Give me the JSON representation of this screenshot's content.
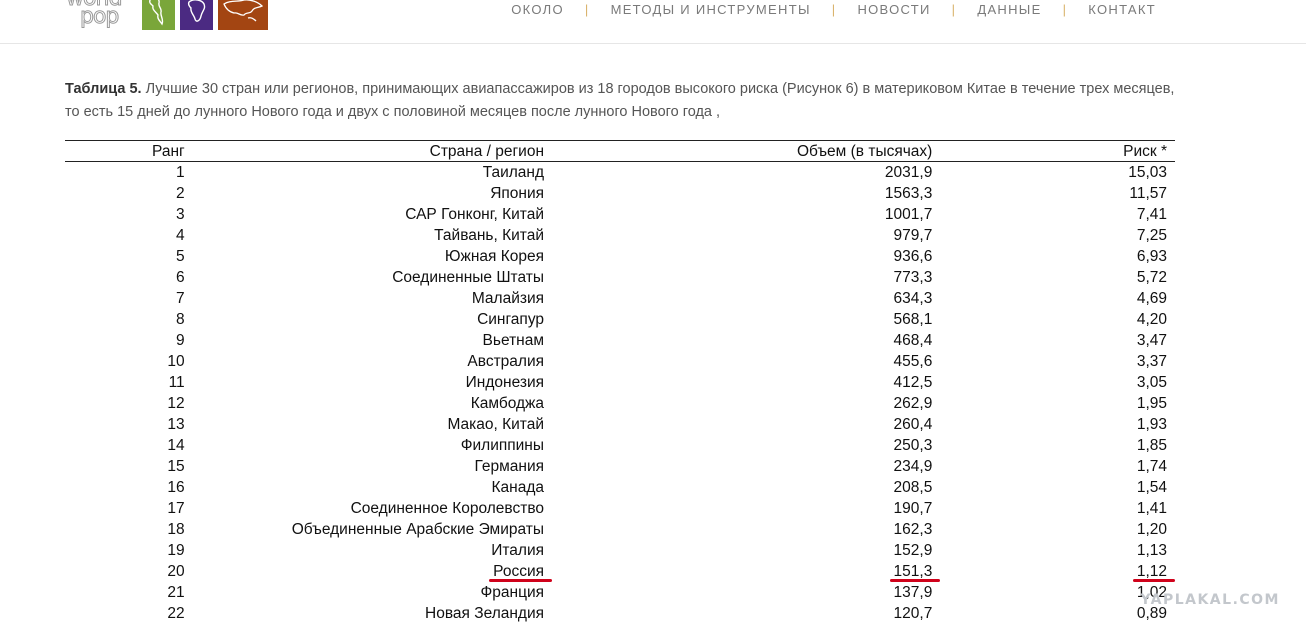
{
  "header": {
    "logo": {
      "line1": "world",
      "line2": "pop",
      "colors": [
        "#7aa63a",
        "#4b2a82",
        "#a34512"
      ]
    },
    "nav": [
      {
        "label": "ОКОЛО"
      },
      {
        "label": "МЕТОДЫ И ИНСТРУМЕНТЫ"
      },
      {
        "label": "НОВОСТИ"
      },
      {
        "label": "ДАННЫЕ"
      },
      {
        "label": "КОНТАКТ"
      }
    ]
  },
  "caption": {
    "label": "Таблица 5.",
    "text": "Лучшие 30 стран или регионов, принимающих авиапассажиров из 18 городов высокого риска (Рисунок 6) в материковом Китае в течение трех месяцев, то есть 15 дней до лунного Нового года и двух с половиной месяцев после лунного Нового года ,"
  },
  "table": {
    "headers": {
      "rank": "Ранг",
      "country": "Страна / регион",
      "volume": "Объем (в тысячах)",
      "risk": "Риск *"
    },
    "rows": [
      {
        "rank": "1",
        "country": "Таиланд",
        "volume": "2031,9",
        "risk": "15,03"
      },
      {
        "rank": "2",
        "country": "Япония",
        "volume": "1563,3",
        "risk": "11,57"
      },
      {
        "rank": "3",
        "country": "САР Гонконг, Китай",
        "volume": "1001,7",
        "risk": "7,41"
      },
      {
        "rank": "4",
        "country": "Тайвань, Китай",
        "volume": "979,7",
        "risk": "7,25"
      },
      {
        "rank": "5",
        "country": "Южная Корея",
        "volume": "936,6",
        "risk": "6,93"
      },
      {
        "rank": "6",
        "country": "Соединенные Штаты",
        "volume": "773,3",
        "risk": "5,72"
      },
      {
        "rank": "7",
        "country": "Малайзия",
        "volume": "634,3",
        "risk": "4,69"
      },
      {
        "rank": "8",
        "country": "Сингапур",
        "volume": "568,1",
        "risk": "4,20"
      },
      {
        "rank": "9",
        "country": "Вьетнам",
        "volume": "468,4",
        "risk": "3,47"
      },
      {
        "rank": "10",
        "country": "Австралия",
        "volume": "455,6",
        "risk": "3,37"
      },
      {
        "rank": "11",
        "country": "Индонезия",
        "volume": "412,5",
        "risk": "3,05"
      },
      {
        "rank": "12",
        "country": "Камбоджа",
        "volume": "262,9",
        "risk": "1,95"
      },
      {
        "rank": "13",
        "country": "Макао, Китай",
        "volume": "260,4",
        "risk": "1,93"
      },
      {
        "rank": "14",
        "country": "Филиппины",
        "volume": "250,3",
        "risk": "1,85"
      },
      {
        "rank": "15",
        "country": "Германия",
        "volume": "234,9",
        "risk": "1,74"
      },
      {
        "rank": "16",
        "country": "Канада",
        "volume": "208,5",
        "risk": "1,54"
      },
      {
        "rank": "17",
        "country": "Соединенное Королевство",
        "volume": "190,7",
        "risk": "1,41"
      },
      {
        "rank": "18",
        "country": "Объединенные Арабские Эмираты",
        "volume": "162,3",
        "risk": "1,20"
      },
      {
        "rank": "19",
        "country": "Италия",
        "volume": "152,9",
        "risk": "1,13"
      },
      {
        "rank": "20",
        "country": "Россия",
        "volume": "151,3",
        "risk": "1,12",
        "highlight": true
      },
      {
        "rank": "21",
        "country": "Франция",
        "volume": "137,9",
        "risk": "1,02"
      },
      {
        "rank": "22",
        "country": "Новая Зеландия",
        "volume": "120,7",
        "risk": "0,89"
      }
    ]
  },
  "highlight_color": "#d0021b",
  "watermark": "YAPLAKAL.COM"
}
